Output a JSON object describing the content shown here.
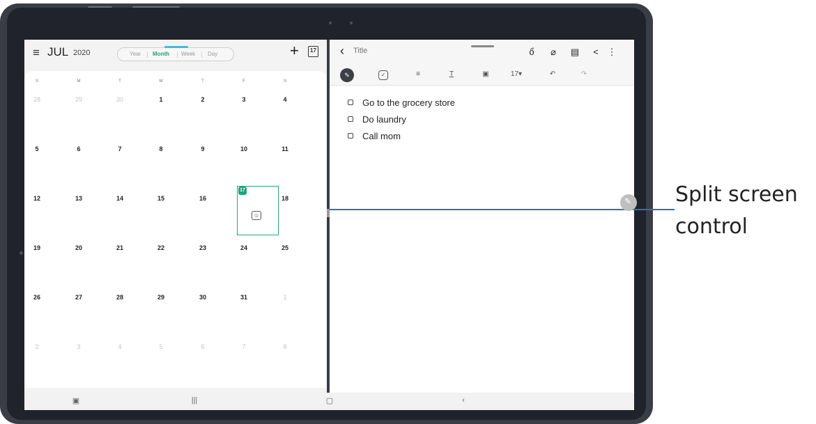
{
  "calendar": {
    "menu_icon": "≡",
    "month": "JUL",
    "year": "2020",
    "views": [
      "Year",
      "Month",
      "Week",
      "Day"
    ],
    "active_view": "Month",
    "add_icon": "+",
    "today_badge": "17",
    "weekdays": [
      "S",
      "M",
      "T",
      "W",
      "T",
      "F",
      "S"
    ],
    "weeks": [
      [
        "28",
        "29",
        "30",
        "1",
        "2",
        "3",
        "4"
      ],
      [
        "5",
        "6",
        "7",
        "8",
        "9",
        "10",
        "11"
      ],
      [
        "12",
        "13",
        "14",
        "15",
        "16",
        "17",
        "18"
      ],
      [
        "19",
        "20",
        "21",
        "22",
        "23",
        "24",
        "25"
      ],
      [
        "26",
        "27",
        "28",
        "29",
        "30",
        "31",
        "1"
      ],
      [
        "2",
        "3",
        "4",
        "5",
        "6",
        "7",
        "8"
      ]
    ],
    "selected_day": "17",
    "accent_color": "#1fa37c"
  },
  "notes": {
    "title_placeholder": "Title",
    "header_icons": [
      "pen-hand-icon",
      "paperclip-icon",
      "document-icon",
      "share-icon",
      "more-icon"
    ],
    "toolbar": {
      "font_size": "17▾",
      "icons": [
        "pen-mode-icon",
        "checkbox-icon",
        "text-style-icon",
        "text-format-icon",
        "insert-icon",
        "undo-icon",
        "redo-icon"
      ]
    },
    "items": [
      {
        "text": "Go to the grocery store"
      },
      {
        "text": "Do laundry"
      },
      {
        "text": "Call mom"
      }
    ]
  },
  "navbar": {
    "icons": [
      "recent-apps-icon",
      "home-icon",
      "back-icon",
      "screen-icon"
    ]
  },
  "callout": {
    "label_line1": "Split screen",
    "label_line2": "control",
    "line_color": "#1f77b4"
  }
}
